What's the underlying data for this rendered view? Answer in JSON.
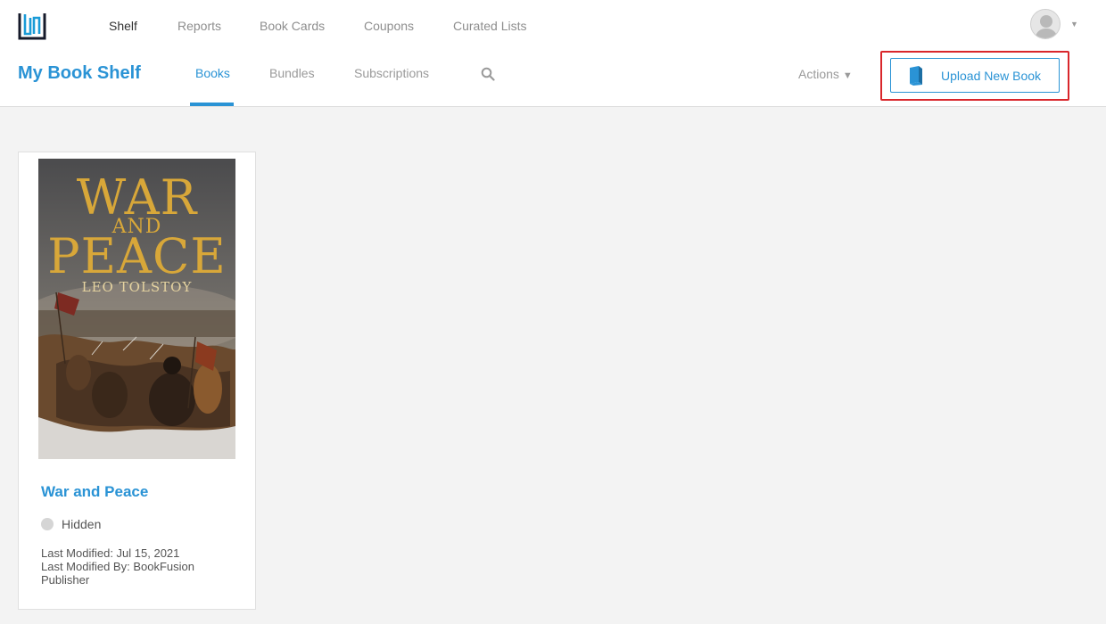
{
  "top_nav": {
    "items": [
      {
        "label": "Shelf",
        "active": true
      },
      {
        "label": "Reports",
        "active": false
      },
      {
        "label": "Book Cards",
        "active": false
      },
      {
        "label": "Coupons",
        "active": false
      },
      {
        "label": "Curated Lists",
        "active": false
      }
    ]
  },
  "header": {
    "page_title": "My Book Shelf",
    "tabs": [
      {
        "label": "Books",
        "active": true
      },
      {
        "label": "Bundles",
        "active": false
      },
      {
        "label": "Subscriptions",
        "active": false
      }
    ],
    "actions_label": "Actions",
    "upload_label": "Upload New Book"
  },
  "book": {
    "cover": {
      "title_line1": "WAR",
      "title_line2": "AND",
      "title_line3": "PEACE",
      "author": "LEO TOLSTOY"
    },
    "title": "War and Peace",
    "status": "Hidden",
    "last_modified": "Last Modified: Jul 15, 2021",
    "last_modified_by": "Last Modified By: BookFusion Publisher"
  },
  "colors": {
    "accent": "#2a93d5",
    "highlight": "#d9262b",
    "status_dot": "#d5d5d5",
    "cover_title": "#d8a739"
  }
}
